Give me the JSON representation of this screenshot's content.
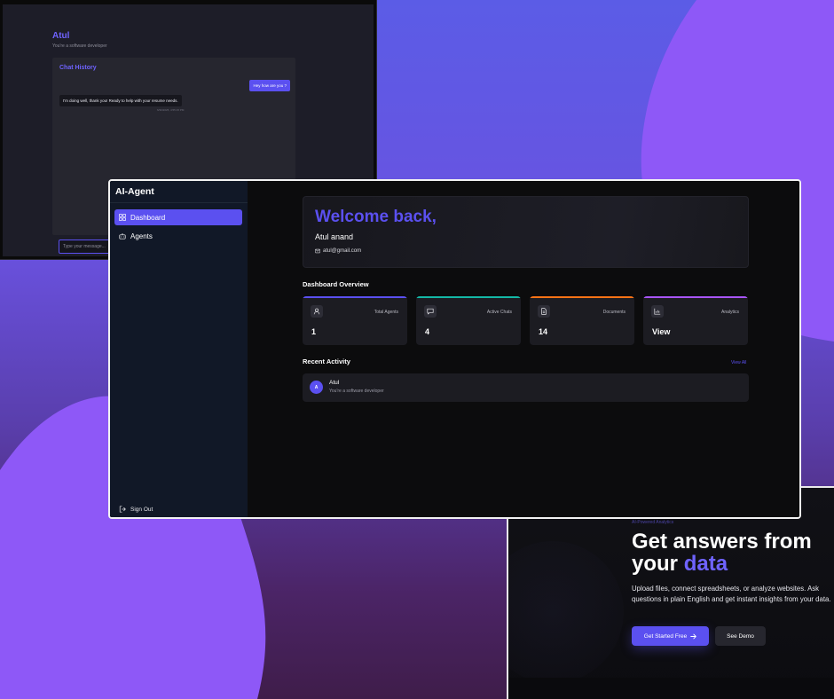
{
  "background": {
    "colors": {
      "blob": "#8e58f7",
      "gradient_top": "#5b5ce6",
      "gradient_bottom": "#3f1d4a"
    }
  },
  "chat_window": {
    "agent_name": "Atul",
    "agent_role": "You're a software developer",
    "history_title": "Chat History",
    "messages": [
      {
        "role": "user",
        "text": "Hey how are you ?"
      },
      {
        "role": "assistant",
        "text": "I'm doing well, thank you! Ready to help with your resume needs.",
        "time": "6/30/2025, 4:55:15 PM"
      }
    ],
    "input_placeholder": "Type your message..."
  },
  "dashboard": {
    "app_name": "AI-Agent",
    "nav": [
      {
        "label": "Dashboard",
        "icon": "dashboard-icon",
        "active": true
      },
      {
        "label": "Agents",
        "icon": "bot-icon",
        "active": false
      }
    ],
    "sign_out_label": "Sign Out",
    "welcome": {
      "title": "Welcome back,",
      "name": "Atul anand",
      "email": "atul@gmail.com"
    },
    "overview_title": "Dashboard Overview",
    "stats": [
      {
        "label": "Total Agents",
        "value": "1",
        "icon": "user-icon",
        "color": "#5b50f0"
      },
      {
        "label": "Active Chats",
        "value": "4",
        "icon": "chat-icon",
        "color": "#14b8a6"
      },
      {
        "label": "Documents",
        "value": "14",
        "icon": "document-icon",
        "color": "#f97316"
      },
      {
        "label": "Analytics",
        "value": "View",
        "icon": "chart-icon",
        "color": "#a855f7"
      }
    ],
    "recent_activity_title": "Recent Activity",
    "view_all_label": "View All",
    "activity": [
      {
        "initial": "A",
        "name": "Atul",
        "description": "You're a software developer"
      }
    ],
    "colors": {
      "accent": "#5b50f0",
      "sidebar": "#111827",
      "main_bg": "#0c0c0d",
      "card": "#1c1c22"
    }
  },
  "landing": {
    "eyebrow": "AI-Powered Analytics",
    "title_line1": "Get answers from",
    "title_line2_prefix": "your",
    "title_accent": "data",
    "description": "Upload files, connect spreadsheets, or analyze websites. Ask questions in plain English and get instant insights from your data.",
    "primary_cta": "Get Started Free",
    "secondary_cta": "See Demo"
  }
}
